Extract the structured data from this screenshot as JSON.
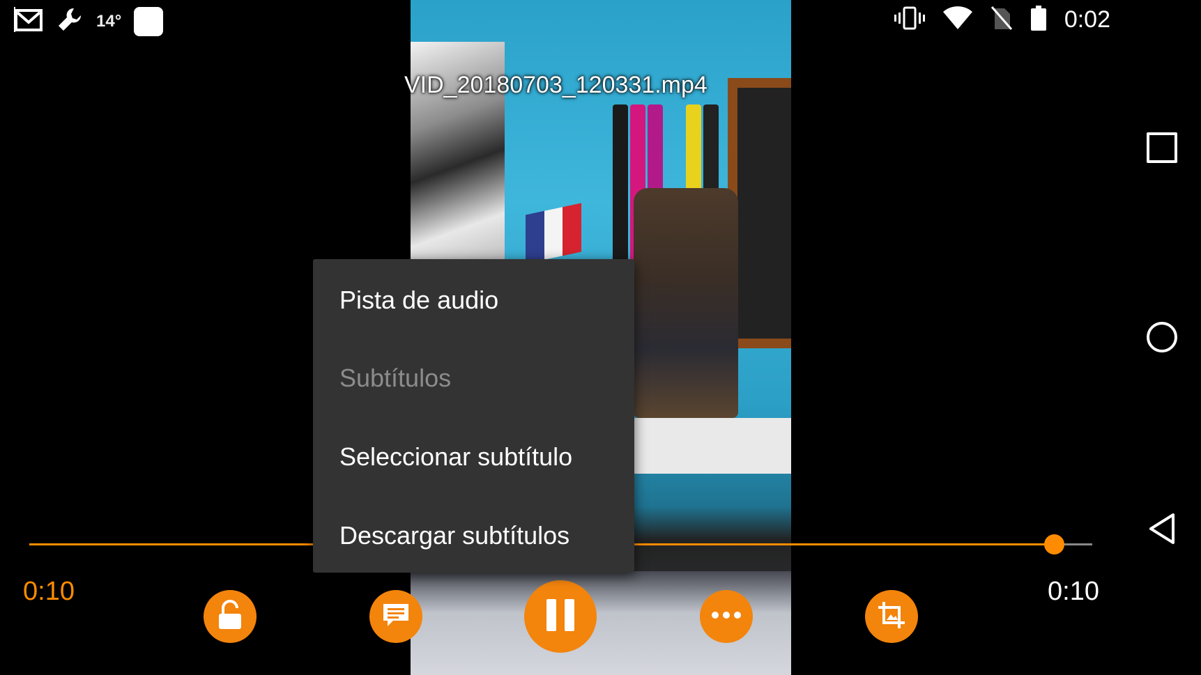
{
  "status_bar": {
    "temperature": "14°",
    "time": "0:02",
    "icons": [
      "gmail-icon",
      "wrench-icon",
      "app-square-icon",
      "vibrate-icon",
      "wifi-icon",
      "no-sim-icon",
      "battery-icon"
    ]
  },
  "player": {
    "video_title": "VID_20180703_120331.mp4",
    "current_time": "0:10",
    "total_time": "0:10",
    "progress": 0.96,
    "accent_color": "#ff8c00",
    "controls": [
      "lock-icon",
      "subtitles-icon",
      "pause-icon",
      "more-options-icon",
      "crop-icon"
    ]
  },
  "menu": {
    "items": [
      {
        "label": "Pista de audio",
        "enabled": true
      },
      {
        "label": "Subtítulos",
        "enabled": false
      },
      {
        "label": "Seleccionar subtítulo",
        "enabled": true
      },
      {
        "label": "Descargar subtítulos",
        "enabled": true
      }
    ]
  },
  "nav_bar": {
    "buttons": [
      "recents-icon",
      "home-icon",
      "back-icon"
    ]
  }
}
